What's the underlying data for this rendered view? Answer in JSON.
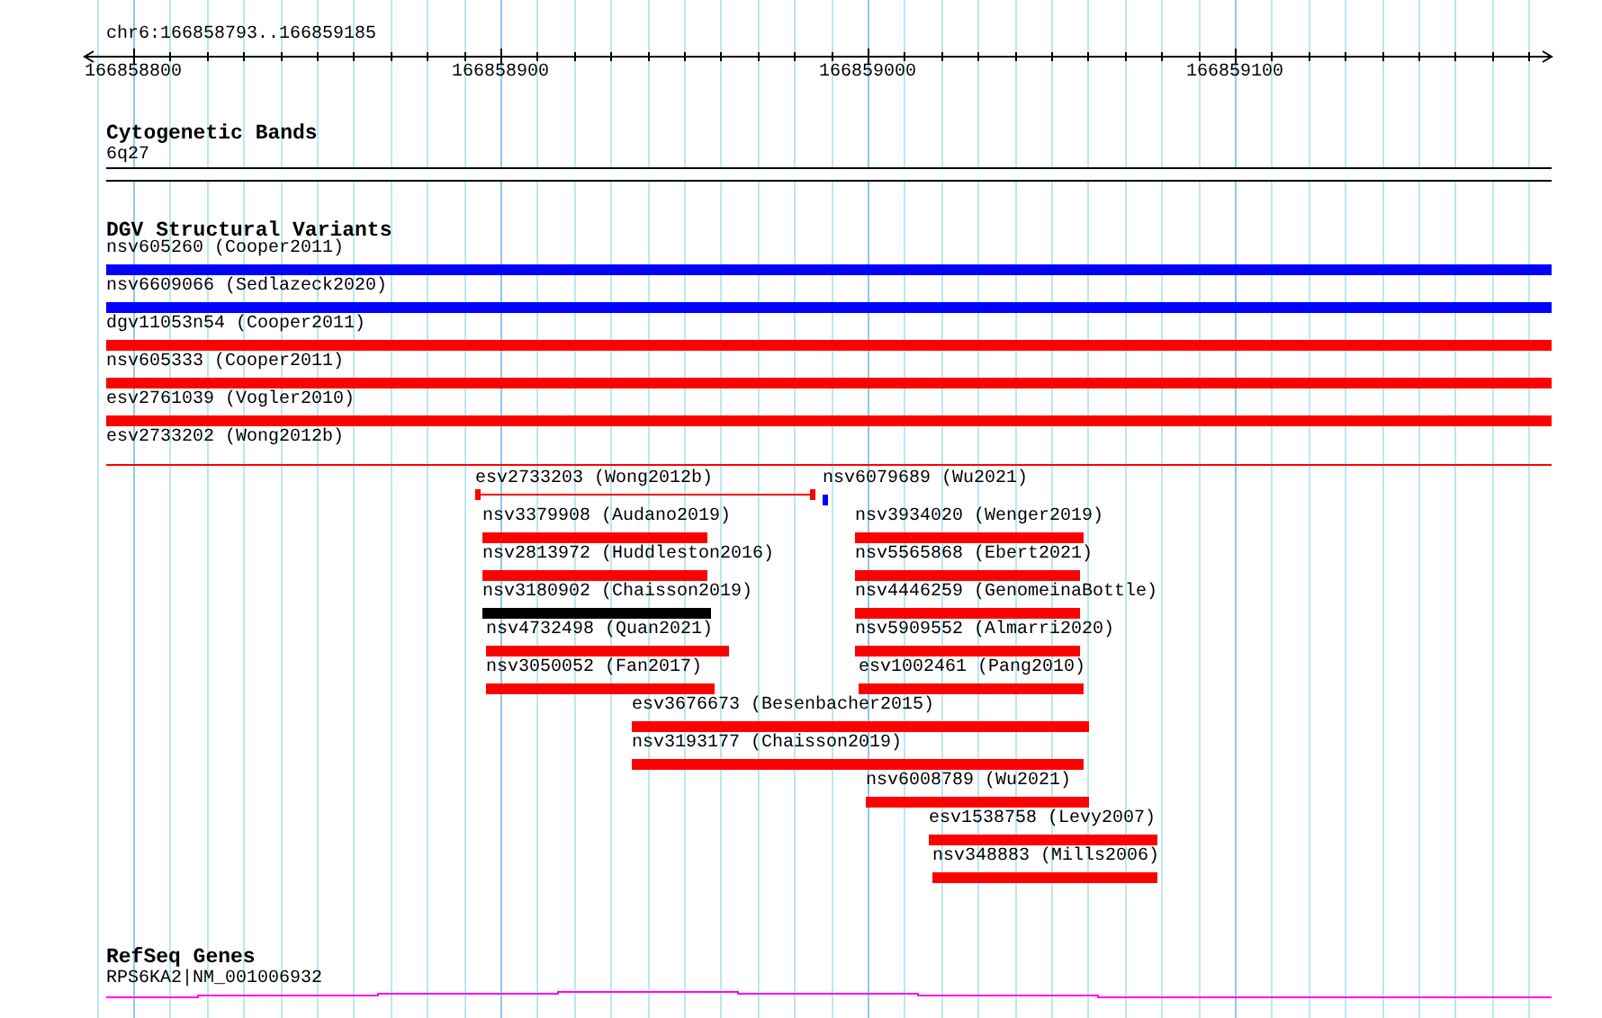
{
  "ruler": {
    "location": "chr6:166858793..166859185",
    "ticks": [
      "166858800",
      "166858900",
      "166859000",
      "166859100"
    ]
  },
  "tracks": [
    {
      "kind": "bands",
      "title": "Cytogenetic Bands",
      "features": [
        {
          "label": "6q27"
        }
      ]
    },
    {
      "kind": "variants",
      "title": "DGV Structural Variants",
      "features": [
        {
          "label": "nsv605260 (Cooper2011)",
          "color": "#0000ff",
          "kind": "bar"
        },
        {
          "label": "nsv6609066 (Sedlazeck2020)",
          "color": "#0000ff",
          "kind": "bar"
        },
        {
          "label": "dgv11053n54 (Cooper2011)",
          "color": "#ff0000",
          "kind": "bar"
        },
        {
          "label": "nsv605333 (Cooper2011)",
          "color": "#ff0000",
          "kind": "bar"
        },
        {
          "label": "esv2761039 (Vogler2010)",
          "color": "#ff0000",
          "kind": "bar"
        },
        {
          "label": "esv2733202 (Wong2012b)",
          "color": "#ff0000",
          "kind": "thin"
        },
        {
          "label": "esv2733203 (Wong2012b)",
          "color": "#ff0000",
          "kind": "gapped"
        },
        {
          "label": "nsv6079689 (Wu2021)",
          "color": "#0000ff",
          "kind": "bar"
        },
        {
          "label": "nsv3379908 (Audano2019)",
          "color": "#ff0000",
          "kind": "bar"
        },
        {
          "label": "nsv3934020 (Wenger2019)",
          "color": "#ff0000",
          "kind": "bar"
        },
        {
          "label": "nsv2813972 (Huddleston2016)",
          "color": "#ff0000",
          "kind": "bar"
        },
        {
          "label": "nsv5565868 (Ebert2021)",
          "color": "#ff0000",
          "kind": "bar"
        },
        {
          "label": "nsv3180902 (Chaisson2019)",
          "color": "#000000",
          "kind": "bar"
        },
        {
          "label": "nsv4446259 (GenomeinaBottle)",
          "color": "#ff0000",
          "kind": "bar"
        },
        {
          "label": "nsv4732498 (Quan2021)",
          "color": "#ff0000",
          "kind": "bar"
        },
        {
          "label": "nsv5909552 (Almarri2020)",
          "color": "#ff0000",
          "kind": "bar"
        },
        {
          "label": "nsv3050052 (Fan2017)",
          "color": "#ff0000",
          "kind": "bar"
        },
        {
          "label": "esv1002461 (Pang2010)",
          "color": "#ff0000",
          "kind": "bar"
        },
        {
          "label": "esv3676673 (Besenbacher2015)",
          "color": "#ff0000",
          "kind": "bar"
        },
        {
          "label": "nsv3193177 (Chaisson2019)",
          "color": "#ff0000",
          "kind": "bar"
        },
        {
          "label": "nsv6008789 (Wu2021)",
          "color": "#ff0000",
          "kind": "bar"
        },
        {
          "label": "esv1538758 (Levy2007)",
          "color": "#ff0000",
          "kind": "bar"
        },
        {
          "label": "nsv348883 (Mills2006)",
          "color": "#ff0000",
          "kind": "bar"
        }
      ]
    },
    {
      "kind": "genes",
      "title": "RefSeq Genes",
      "features": [
        {
          "label": "RPS6KA2|NM_001006932"
        }
      ]
    }
  ]
}
